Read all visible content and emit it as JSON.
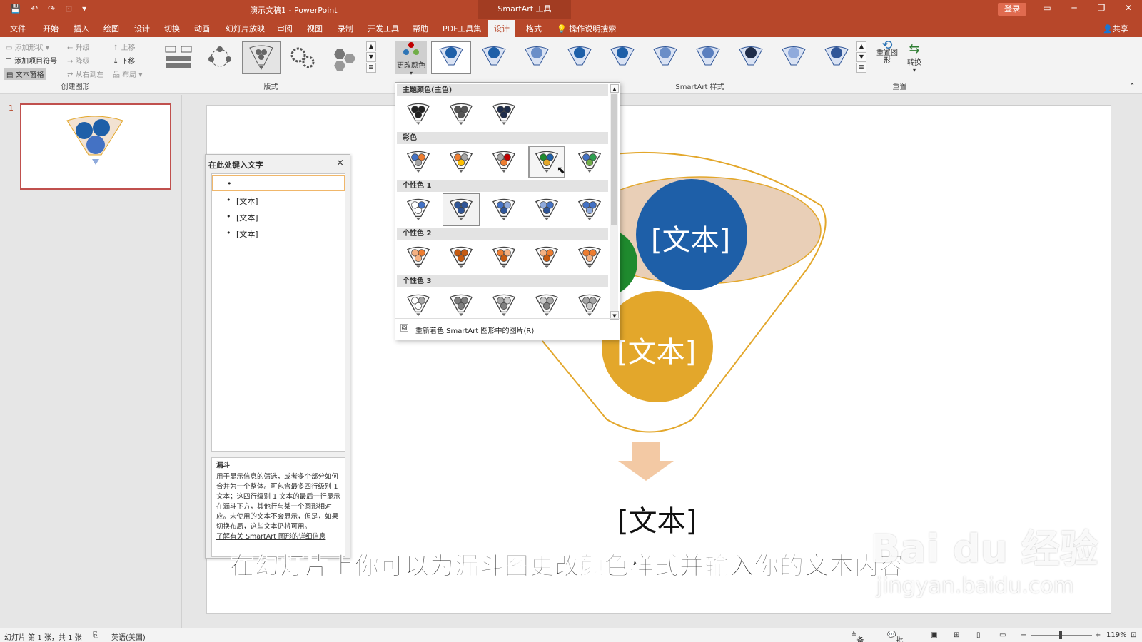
{
  "titlebar": {
    "doc_title": "演示文稿1 - PowerPoint",
    "tool_context": "SmartArt 工具",
    "login": "登录",
    "win_min": "─",
    "win_max": "❐",
    "win_close": "✕"
  },
  "tabs": [
    "文件",
    "开始",
    "插入",
    "绘图",
    "设计",
    "切换",
    "动画",
    "幻灯片放映",
    "审阅",
    "视图",
    "录制",
    "开发工具",
    "帮助",
    "PDF工具集",
    "设计",
    "格式"
  ],
  "active_tab_index": 14,
  "tellme": "操作说明搜索",
  "share": "共享",
  "ribbon": {
    "create": {
      "add_shape": "添加形状",
      "add_bullet": "添加项目符号",
      "text_pane": "文本窗格",
      "promote": "升级",
      "demote": "降级",
      "rtl": "从右到左",
      "move_up": "上移",
      "move_down": "下移",
      "layout": "布局",
      "label": "创建图形"
    },
    "layouts_label": "版式",
    "change_colors": "更改颜色",
    "styles_label": "SmartArt 样式",
    "reset": "重置图形",
    "convert": "转换",
    "reset_label": "重置"
  },
  "thumbs": {
    "slide_num": "1"
  },
  "text_pane": {
    "title": "在此处键入文字",
    "close": "×",
    "items": [
      "",
      "[文本]",
      "[文本]",
      "[文本]"
    ],
    "desc_title": "漏斗",
    "desc_body": "用于显示信息的筛选，或者多个部分如何合并为一个整体。可包含最多四行级别 1 文本；这四行级别 1 文本的最后一行显示在漏斗下方，其他行与某一个圆形相对应。未使用的文本不会显示，但是，如果切换布局，这些文本仍将可用。",
    "desc_link": "了解有关 SmartArt 图形的详细信息"
  },
  "color_dropdown": {
    "sections": [
      "主题颜色(主色)",
      "彩色",
      "个性色 1",
      "个性色 2",
      "个性色 3"
    ],
    "footer": "重新着色 SmartArt 图形中的图片(R)",
    "palettes": [
      [
        [
          "#222222",
          "#222222",
          "#222222"
        ],
        [
          "#555555",
          "#555555",
          "#555555"
        ],
        [
          "#1f2d4a",
          "#1f2d4a",
          "#1f2d4a"
        ]
      ],
      [
        [
          "#4472c4",
          "#ed7d31",
          "#a5a5a5"
        ],
        [
          "#ed7d31",
          "#a5a5a5",
          "#ffc000"
        ],
        [
          "#a5a5a5",
          "#c00000",
          "#ed7d31"
        ],
        [
          "#1f8a2e",
          "#1e5fa8",
          "#e3a72b"
        ],
        [
          "#4472c4",
          "#2e9e4f",
          "#70ad47"
        ]
      ],
      [
        [
          "#ffffff",
          "#4472c4",
          "#ffffff"
        ],
        [
          "#2f5597",
          "#2f5597",
          "#2f5597"
        ],
        [
          "#4472c4",
          "#8faadc",
          "#2f5597"
        ],
        [
          "#8faadc",
          "#4472c4",
          "#2f5597"
        ],
        [
          "#4472c4",
          "#4472c4",
          "#8faadc"
        ]
      ],
      [
        [
          "#f4b183",
          "#ed7d31",
          "#f4b183"
        ],
        [
          "#c55a11",
          "#c55a11",
          "#c55a11"
        ],
        [
          "#ed7d31",
          "#f4b183",
          "#c55a11"
        ],
        [
          "#f4b183",
          "#ed7d31",
          "#c55a11"
        ],
        [
          "#ed7d31",
          "#ed7d31",
          "#f4b183"
        ]
      ],
      [
        [
          "#ffffff",
          "#a5a5a5",
          "#ffffff"
        ],
        [
          "#7f7f7f",
          "#7f7f7f",
          "#7f7f7f"
        ],
        [
          "#a5a5a5",
          "#c9c9c9",
          "#7f7f7f"
        ],
        [
          "#c9c9c9",
          "#a5a5a5",
          "#7f7f7f"
        ],
        [
          "#a5a5a5",
          "#a5a5a5",
          "#c9c9c9"
        ]
      ]
    ],
    "selected": [
      2,
      1
    ],
    "hover": [
      1,
      3
    ]
  },
  "slide": {
    "circle_blue_text": "[文本]",
    "circle_yellow_text": "[文本]",
    "circle_green_text": "]",
    "bottom_text": "[文本]",
    "colors": {
      "blue": "#1e5fa8",
      "yellow": "#e3a72b",
      "green": "#1f8a2e",
      "funnel_line": "#e3a72b",
      "funnel_fill": "#e9cfb7",
      "arrow": "#f3c9a4"
    }
  },
  "subtitle": "在幻灯片上你可以为漏斗图更改颜色样式并输入你的文本内容",
  "watermark": {
    "brand": "Bai du 经验",
    "url": "jingyan.baidu.com"
  },
  "statusbar": {
    "slide_info": "幻灯片 第 1 张，共 1 张",
    "lang": "英语(美国)",
    "notes": "备注",
    "comments": "批注",
    "zoom": "119%"
  }
}
